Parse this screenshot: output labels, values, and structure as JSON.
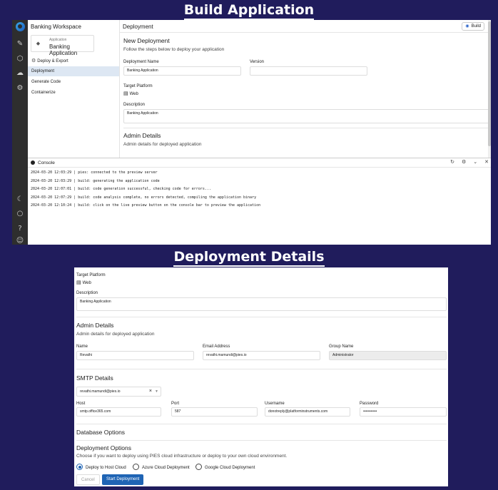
{
  "banners": {
    "top": "Build Application",
    "middle": "Deployment Details"
  },
  "sidebar": {
    "workspace_title": "Banking Workspace",
    "app_card": {
      "caption": "Application",
      "name": "Banking Application"
    },
    "items": [
      {
        "label": "Deploy & Export",
        "icon": "gear-icon"
      },
      {
        "label": "Deployment"
      },
      {
        "label": "Generate Code"
      },
      {
        "label": "Containerize"
      }
    ]
  },
  "topbar": {
    "title": "Deployment",
    "build_label": "Build"
  },
  "new_deployment": {
    "heading": "New Deployment",
    "subtitle": "Follow the steps below to deploy your application",
    "name_label": "Deployment Name",
    "name_value": "Banking Application",
    "version_label": "Version",
    "version_value": "",
    "platform_label": "Target Platform",
    "platform_value": "Web",
    "description_label": "Description",
    "description_value": "Banking Application"
  },
  "admin": {
    "heading": "Admin Details",
    "subtitle": "Admin details for deployed application",
    "name_label": "Name",
    "name_value": "Revathi",
    "email_label": "Email Address",
    "email_value": "revathi.mamundi@pies.io",
    "group_label": "Group Name",
    "group_value": "Administrator"
  },
  "smtp": {
    "heading": "SMTP Details",
    "selected": "revathi.mamundi@pies.io",
    "host_label": "Host",
    "host_value": "smtp.office365.com",
    "port_label": "Port",
    "port_value": "587",
    "username_label": "Username",
    "username_value": "donotreply@platforminstruments.com",
    "password_label": "Password",
    "password_value": "•••••••••••"
  },
  "database": {
    "heading": "Database Options"
  },
  "deploy_options": {
    "heading": "Deployment Options",
    "subtitle": "Choose if you want to deploy using PIES cloud infrastructure or deploy to your own cloud environment.",
    "options": [
      "Deploy to Host Cloud",
      "Azure Cloud Deployment",
      "Google Cloud Deployment"
    ],
    "selected_index": 0
  },
  "actions": {
    "cancel": "Cancel",
    "start": "Start Deployment"
  },
  "console": {
    "title": "Console",
    "logs": [
      "2024-03-20 12:03:29 | pies: connected to the preview server",
      "2024-03-20 12:03:29 | build: generating the application code",
      "2024-03-20 12:07:01 | build: code generation successful, checking code for errors...",
      "2024-03-20 12:07:29 | build: code analysis complete, no errors detected, compiling the application binary",
      "2024-03-20 12:10:24 | build: click on the live preview button on the console bar to preview the application"
    ]
  },
  "colors": {
    "page_bg": "#201c5c",
    "accent": "#1f64b4",
    "rail": "#2e2e2e",
    "active_nav": "#dde7f3"
  }
}
